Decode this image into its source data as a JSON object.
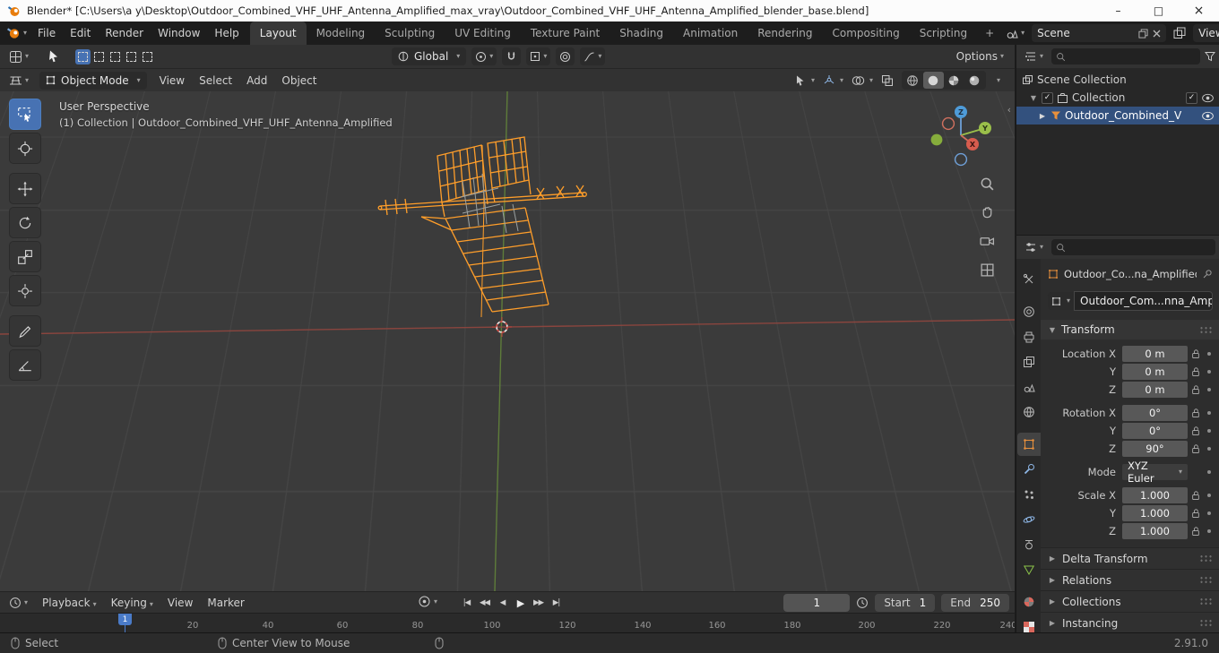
{
  "window": {
    "title": "Blender* [C:\\Users\\a y\\Desktop\\Outdoor_Combined_VHF_UHF_Antenna_Amplified_max_vray\\Outdoor_Combined_VHF_UHF_Antenna_Amplified_blender_base.blend]",
    "minimize": "–",
    "maximize": "□",
    "close": "×"
  },
  "topbar": {
    "menus": [
      {
        "label": "File"
      },
      {
        "label": "Edit"
      },
      {
        "label": "Render"
      },
      {
        "label": "Window"
      },
      {
        "label": "Help"
      }
    ],
    "workspaces": [
      {
        "label": "Layout"
      },
      {
        "label": "Modeling"
      },
      {
        "label": "Sculpting"
      },
      {
        "label": "UV Editing"
      },
      {
        "label": "Texture Paint"
      },
      {
        "label": "Shading"
      },
      {
        "label": "Animation"
      },
      {
        "label": "Rendering"
      },
      {
        "label": "Compositing"
      },
      {
        "label": "Scripting"
      }
    ],
    "add_workspace": "+",
    "scene_value": "Scene",
    "view_layer_value": "View Layer"
  },
  "tool_header": {
    "orientation": "Global",
    "options": "Options"
  },
  "object_header": {
    "mode": "Object Mode",
    "menus": [
      {
        "label": "View"
      },
      {
        "label": "Select"
      },
      {
        "label": "Add"
      },
      {
        "label": "Object"
      }
    ]
  },
  "viewport": {
    "overlay_title": "User Perspective",
    "overlay_breadcrumb": "(1) Collection | Outdoor_Combined_VHF_UHF_Antenna_Amplified",
    "axis_x": "X",
    "axis_y": "Y",
    "axis_z": "Z"
  },
  "outliner": {
    "rows": [
      {
        "label": "Scene Collection"
      },
      {
        "label": "Collection"
      },
      {
        "label": "Outdoor_Combined_V"
      }
    ]
  },
  "properties": {
    "breadcrumb": "Outdoor_Co...na_Amplified",
    "object_name": "Outdoor_Com...nna_Amplified",
    "transform_title": "Transform",
    "transform_rows": [
      {
        "label": "Location X",
        "value": "0 m"
      },
      {
        "label": "Y",
        "value": "0 m"
      },
      {
        "label": "Z",
        "value": "0 m"
      },
      {
        "label": "Rotation X",
        "value": "0°"
      },
      {
        "label": "Y",
        "value": "0°"
      },
      {
        "label": "Z",
        "value": "90°"
      },
      {
        "label": "Mode",
        "value": "XYZ Euler"
      },
      {
        "label": "Scale X",
        "value": "1.000"
      },
      {
        "label": "Y",
        "value": "1.000"
      },
      {
        "label": "Z",
        "value": "1.000"
      }
    ],
    "sections": [
      {
        "label": "Delta Transform"
      },
      {
        "label": "Relations"
      },
      {
        "label": "Collections"
      },
      {
        "label": "Instancing"
      }
    ]
  },
  "timeline": {
    "menus": [
      {
        "label": "Playback"
      },
      {
        "label": "Keying"
      },
      {
        "label": "View"
      },
      {
        "label": "Marker"
      }
    ],
    "current_frame": "1",
    "start_label": "Start",
    "start_value": "1",
    "end_label": "End",
    "end_value": "250",
    "ticks": [
      "20",
      "40",
      "60",
      "80",
      "100",
      "120",
      "140",
      "160",
      "180",
      "200",
      "220",
      "240"
    ]
  },
  "status": {
    "left": "Select",
    "middle": "Center View to Mouse",
    "version": "2.91.0"
  },
  "colors": {
    "accent_blue": "#4772b3",
    "selection_orange": "#ff9e2a",
    "axis_x_red": "#8f463f",
    "axis_y_green": "#60803a"
  }
}
